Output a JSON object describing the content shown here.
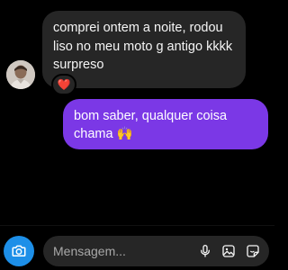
{
  "messages": {
    "incoming": {
      "text": "comprei ontem a noite, rodou liso no meu moto g antigo kkkk surpreso",
      "reaction": "❤️"
    },
    "outgoing": {
      "text": "bom saber, qualquer coisa chama 🙌"
    }
  },
  "composer": {
    "placeholder": "Mensagem..."
  },
  "colors": {
    "background": "#000000",
    "incoming_bubble": "#262626",
    "outgoing_bubble": "#7b38e6",
    "camera_button": "#1d8fe8"
  },
  "icons": [
    "camera-icon",
    "microphone-icon",
    "image-icon",
    "sticker-icon",
    "heart-icon"
  ]
}
